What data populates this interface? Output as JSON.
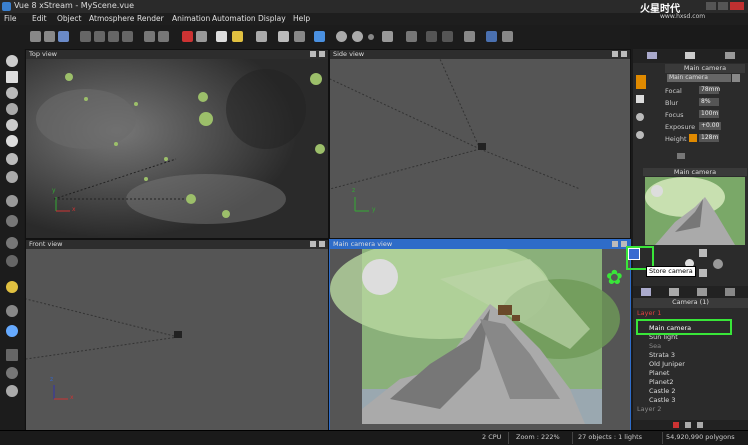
{
  "window": {
    "title": "Vue 8 xStream - MyScene.vue"
  },
  "watermark": {
    "text": "火星时代",
    "url": "www.hxsd.com"
  },
  "menu": [
    "File",
    "Edit",
    "Object",
    "Atmosphere",
    "Render",
    "Animation",
    "Automation",
    "Display",
    "Help"
  ],
  "viewports": {
    "top": "Top view",
    "side": "Side view",
    "front": "Front view",
    "camera": "Main camera view"
  },
  "axes": {
    "x": "x",
    "y": "y",
    "z": "z"
  },
  "camera_panel": {
    "header": "Main camera",
    "selected": "Main camera",
    "fields": [
      {
        "label": "Focal",
        "value": "78mm"
      },
      {
        "label": "Blur",
        "value": "8%"
      },
      {
        "label": "Focus",
        "value": "100m"
      },
      {
        "label": "Exposure",
        "value": "+0.00"
      },
      {
        "label": "Height",
        "value": "128m"
      }
    ]
  },
  "preview": {
    "title": "Main camera"
  },
  "tooltip": {
    "text": "Store camera"
  },
  "layers": {
    "header": "Camera (1)",
    "items": [
      {
        "label": "Layer 1",
        "color": "#e04040"
      },
      {
        "label": "Main camera",
        "color": "#ffffff"
      },
      {
        "label": "Sun light",
        "color": "#dddddd"
      },
      {
        "label": "Sea",
        "color": "#888888"
      },
      {
        "label": "Strata 3",
        "color": "#dddddd"
      },
      {
        "label": "Old Juniper",
        "color": "#dddddd"
      },
      {
        "label": "Planet",
        "color": "#dddddd"
      },
      {
        "label": "Planet2",
        "color": "#dddddd"
      },
      {
        "label": "Castle 2",
        "color": "#dddddd"
      },
      {
        "label": "Castle 3",
        "color": "#dddddd"
      },
      {
        "label": "Layer 2",
        "color": "#888888"
      }
    ]
  },
  "status": {
    "cpu": "2 CPU",
    "zoom": "Zoom : 222%",
    "objects": "27 objects : 1 lights",
    "polygons": "54,920,990 polygons"
  },
  "colors": {
    "accent": "#2e6cc8",
    "highlight": "#39e639",
    "orange": "#e08a00"
  }
}
